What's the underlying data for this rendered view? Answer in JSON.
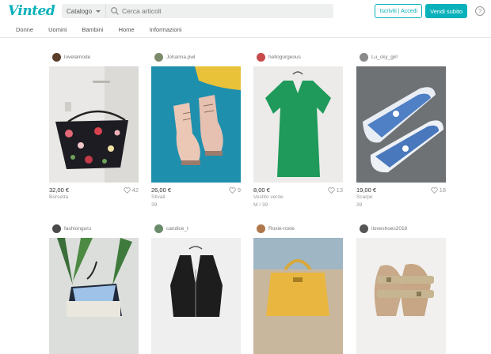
{
  "header": {
    "logo": "Vinted",
    "category_label": "Catalogo",
    "search_placeholder": "Cerca articoli",
    "signin_label": "Iscriviti | Accedi",
    "sell_label": "Vendi subito",
    "help_glyph": "?"
  },
  "nav": {
    "items": [
      "Donne",
      "Uomini",
      "Bambini",
      "Home",
      "Informazioni"
    ]
  },
  "products": [
    {
      "user": "lovelamode",
      "price": "32,00 €",
      "likes": "42",
      "line1": "Borsetta",
      "line2": ""
    },
    {
      "user": "Johanna.pwl",
      "price": "26,00 €",
      "likes": "9",
      "line1": "Stivali",
      "line2": "39"
    },
    {
      "user": "hellogorgeous",
      "price": "8,00 €",
      "likes": "13",
      "line1": "Vestito verde",
      "line2": "M / 39"
    },
    {
      "user": "Lu_cky_girl",
      "price": "19,00 €",
      "likes": "18",
      "line1": "Scarpe",
      "line2": "39"
    },
    {
      "user": "fashionguru",
      "price": "",
      "likes": "",
      "line1": "",
      "line2": ""
    },
    {
      "user": "candice_t",
      "price": "",
      "likes": "",
      "line1": "",
      "line2": ""
    },
    {
      "user": "Roxie-roxie",
      "price": "",
      "likes": "",
      "line1": "",
      "line2": ""
    },
    {
      "user": "iloveshoes2018",
      "price": "",
      "likes": "",
      "line1": "",
      "line2": ""
    }
  ],
  "icons": {
    "search": "search-icon",
    "heart": "heart-icon",
    "help": "help-icon",
    "caret": "chevron-down-icon"
  },
  "colors": {
    "brand": "#09b1ba"
  }
}
